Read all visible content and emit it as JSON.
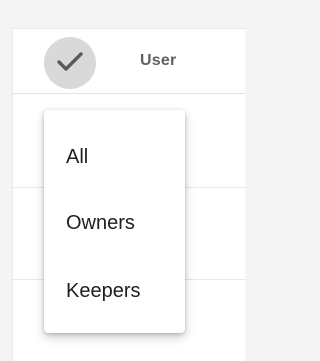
{
  "table": {
    "header": {
      "select_all_icon": "checkmark-icon",
      "column_label": "User"
    }
  },
  "filter_menu": {
    "items": [
      {
        "label": "All"
      },
      {
        "label": "Owners"
      },
      {
        "label": "Keepers"
      }
    ]
  }
}
